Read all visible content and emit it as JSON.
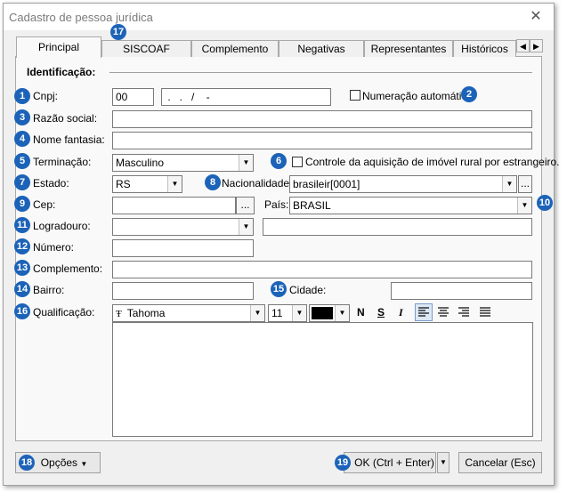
{
  "window": {
    "title": "Cadastro de pessoa jurídica",
    "close_glyph": "✕"
  },
  "tabs": [
    "Principal",
    "SISCOAF",
    "Complemento",
    "Negativas",
    "Representantes",
    "Históricos"
  ],
  "section": {
    "title": "Identificação:"
  },
  "badges": [
    "1",
    "2",
    "3",
    "4",
    "5",
    "6",
    "7",
    "8",
    "9",
    "10",
    "11",
    "12",
    "13",
    "14",
    "15",
    "16",
    "17",
    "18",
    "19"
  ],
  "fields": {
    "cnpj": {
      "label": "Cnpj:",
      "value1": "00",
      "value2": " .   .   /    -"
    },
    "numeracao": {
      "label": "Numeração automática"
    },
    "razao_social": {
      "label": "Razão social:",
      "value": ""
    },
    "nome_fantasia": {
      "label": "Nome fantasia:",
      "value": ""
    },
    "terminacao": {
      "label": "Terminação:",
      "value": "Masculino"
    },
    "controle": {
      "label": "Controle da aquisição de imóvel rural por estrangeiro."
    },
    "estado": {
      "label": "Estado:",
      "value": "RS"
    },
    "nacionalidade": {
      "label": "Nacionalidade:",
      "value": "brasileir[0001]",
      "ellipsis": "..."
    },
    "cep": {
      "label": "Cep:",
      "value": "",
      "ellipsis": "..."
    },
    "pais": {
      "label": "País:",
      "value": "BRASIL"
    },
    "logradouro": {
      "label": "Logradouro:",
      "value": ""
    },
    "numero": {
      "label": "Número:",
      "value": ""
    },
    "complemento": {
      "label": "Complemento:",
      "value": ""
    },
    "bairro": {
      "label": "Bairro:",
      "value": ""
    },
    "cidade": {
      "label": "Cidade:",
      "value": ""
    },
    "qualificacao": {
      "label": "Qualificação:"
    }
  },
  "editor_toolbar": {
    "font": "Tahoma",
    "font_size": "11",
    "bold": "N",
    "underline": "S",
    "italic": "I",
    "color": "#000000"
  },
  "buttons": {
    "opcoes": "Opções",
    "ok": "OK (Ctrl + Enter)",
    "cancelar": "Cancelar (Esc)"
  },
  "colors": {
    "badge": "#1c63b8"
  }
}
